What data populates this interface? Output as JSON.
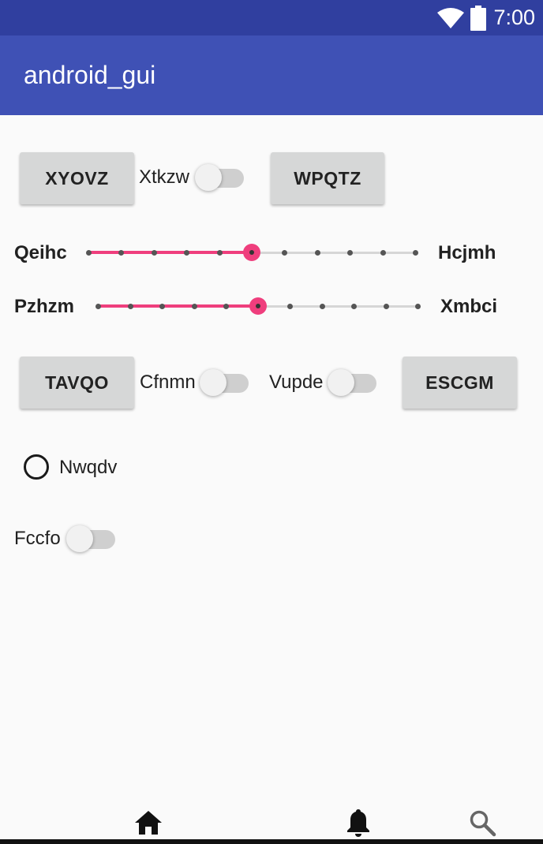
{
  "status_bar": {
    "time": "7:00",
    "icons": [
      "wifi-icon",
      "battery-icon"
    ]
  },
  "app_bar": {
    "title": "android_gui"
  },
  "row1": {
    "button_left": "XYOVZ",
    "switch_label": "Xtkzw",
    "switch_on": false,
    "button_right": "WPQTZ"
  },
  "slider1": {
    "label_left": "Qeihc",
    "label_right": "Hcjmh",
    "steps": 10,
    "value": 5
  },
  "slider2": {
    "label_left": "Pzhzm",
    "label_right": "Xmbci",
    "steps": 10,
    "value": 5
  },
  "row2": {
    "button_left": "TAVQO",
    "switch1_label": "Cfnmn",
    "switch1_on": false,
    "switch2_label": "Vupde",
    "switch2_on": false,
    "button_right": "ESCGM"
  },
  "radio": {
    "label": "Nwqdv",
    "checked": false
  },
  "bottom_switch": {
    "label": "Fccfo",
    "on": false
  },
  "bottom_nav": {
    "icons": [
      "home-icon",
      "bell-icon",
      "search-icon"
    ]
  },
  "colors": {
    "primary": "#3f51b5",
    "primary_dark": "#303f9f",
    "accent": "#ef3e7d"
  }
}
